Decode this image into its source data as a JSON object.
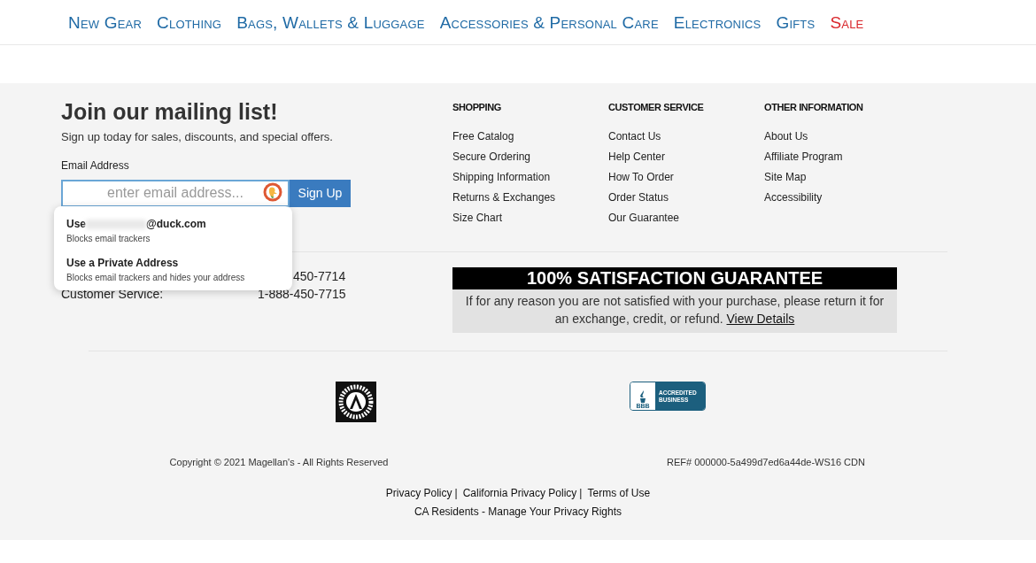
{
  "nav": [
    {
      "label": "New Gear",
      "kind": "normal"
    },
    {
      "label": "Clothing",
      "kind": "normal"
    },
    {
      "label": "Bags, Wallets & Luggage",
      "kind": "normal"
    },
    {
      "label": "Accessories & Personal Care",
      "kind": "normal"
    },
    {
      "label": "Electronics",
      "kind": "normal"
    },
    {
      "label": "Gifts",
      "kind": "normal"
    },
    {
      "label": "Sale",
      "kind": "sale"
    }
  ],
  "mailing": {
    "title": "Join our mailing list!",
    "subtitle": "Sign up today for sales, discounts, and special offers.",
    "field_label": "Email Address",
    "placeholder": "enter email address...",
    "button": "Sign Up"
  },
  "autofill_popup": {
    "options": [
      {
        "prefix": "Use",
        "suffix": "@duck.com",
        "description": "Blocks email trackers"
      },
      {
        "title": "Use a Private Address",
        "description": "Blocks email trackers and hides your address"
      }
    ]
  },
  "phones": [
    {
      "number": "450-7714"
    },
    {
      "label": "Customer Service:",
      "number": "1-888-450-7715"
    }
  ],
  "link_columns": [
    {
      "heading": "SHOPPING",
      "links": [
        "Free Catalog",
        "Secure Ordering",
        "Shipping Information",
        "Returns & Exchanges",
        "Size Chart"
      ]
    },
    {
      "heading": "CUSTOMER SERVICE",
      "links": [
        "Contact Us",
        "Help Center",
        "How To Order",
        "Order Status",
        "Our Guarantee"
      ]
    },
    {
      "heading": "OTHER INFORMATION",
      "links": [
        "About Us",
        "Affiliate Program",
        "Site Map",
        "Accessibility"
      ]
    }
  ],
  "guarantee": {
    "title": "100% SATISFACTION GUARANTEE",
    "text": "If for any reason you are not satisfied with your purchase, please return it for an exchange, credit, or refund.",
    "link": "View Details"
  },
  "badges": {
    "bbb_line1": "ACCREDITED",
    "bbb_line2": "BUSINESS",
    "bbb_short": "BBB"
  },
  "copyright": "Copyright © 2021 Magellan's - All Rights Reserved",
  "ref": "REF# 000000-5a499d7ed6a44de-WS16 CDN",
  "legal_links": [
    {
      "label": "Privacy Policy",
      "separator": "|"
    },
    {
      "label": "California Privacy Policy",
      "separator": "|"
    },
    {
      "label": "Terms of Use"
    }
  ],
  "privacy_rights": "CA Residents - Manage Your Privacy Rights"
}
